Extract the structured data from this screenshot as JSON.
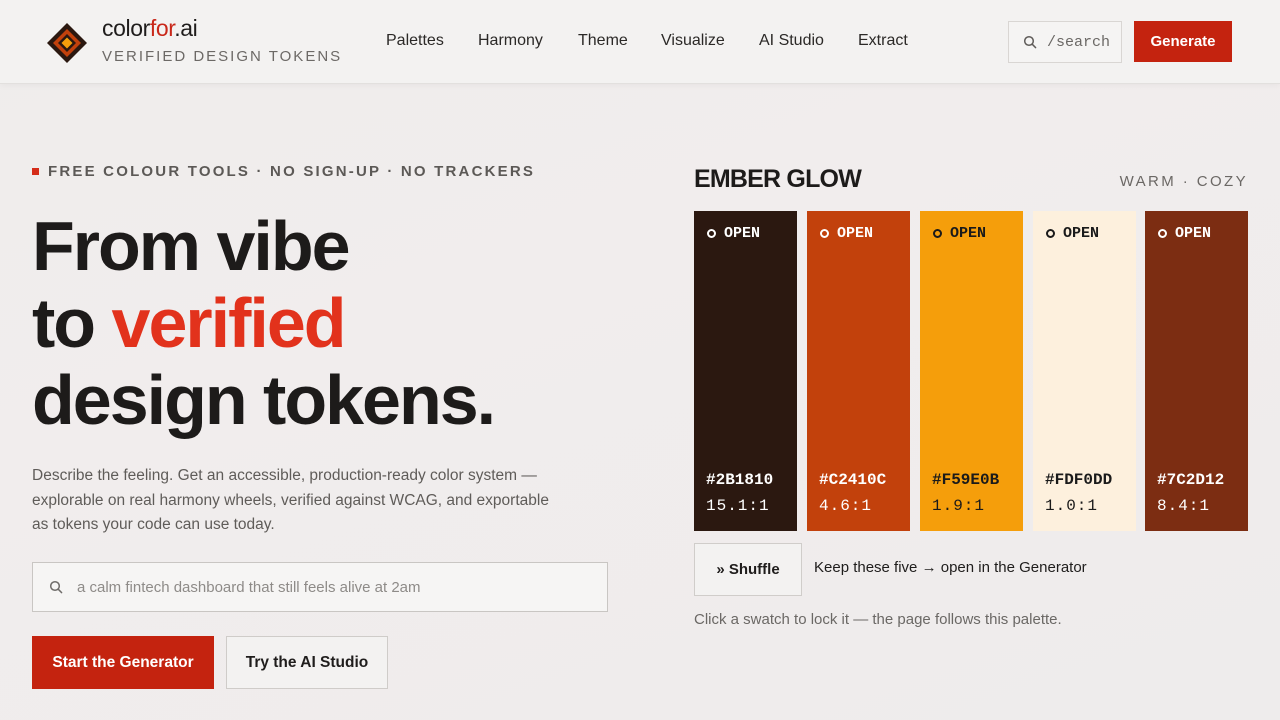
{
  "header": {
    "brand_prefix": "color",
    "brand_accent": "for",
    "brand_suffix": ".ai",
    "tagline": "VERIFIED DESIGN TOKENS",
    "nav": [
      "Palettes",
      "Harmony",
      "Theme",
      "Visualize",
      "AI Studio",
      "Extract"
    ],
    "search_label": "/search",
    "generate_label": "Generate"
  },
  "hero": {
    "eyebrow": "FREE COLOUR TOOLS · NO SIGN-UP · NO TRACKERS",
    "line1": "From vibe",
    "line2_a": "to ",
    "line2_b": "verified",
    "line3": "design tokens.",
    "description": "Describe the feeling. Get an accessible, production-ready color system — explorable on real harmony wheels, verified against WCAG, and exportable as tokens your code can use today.",
    "prompt_placeholder": "a calm fintech dashboard that still feels alive at 2am",
    "primary_cta": "Start the Generator",
    "secondary_cta": "Try the AI Studio"
  },
  "palette": {
    "name": "EMBER GLOW",
    "mood": "WARM · COZY",
    "open_label": "OPEN",
    "swatches": [
      {
        "hex": "#2B1810",
        "ratio": "15.1:1",
        "fg": "#ffffff"
      },
      {
        "hex": "#C2410C",
        "ratio": "4.6:1",
        "fg": "#ffffff"
      },
      {
        "hex": "#F59E0B",
        "ratio": "1.9:1",
        "fg": "#1a1a1a"
      },
      {
        "hex": "#FDF0DD",
        "ratio": "1.0:1",
        "fg": "#1a1a1a"
      },
      {
        "hex": "#7C2D12",
        "ratio": "8.4:1",
        "fg": "#ffffff"
      }
    ],
    "shuffle_label": "» Shuffle",
    "keep_label": "Keep these five → open in the Generator",
    "hint": "Click a swatch to lock it — the page follows this palette."
  },
  "colors": {
    "accent": "#C4230F",
    "headline_accent": "#E2321C",
    "logo_outer": "#C2410C",
    "logo_inner": "#F59E0B"
  }
}
